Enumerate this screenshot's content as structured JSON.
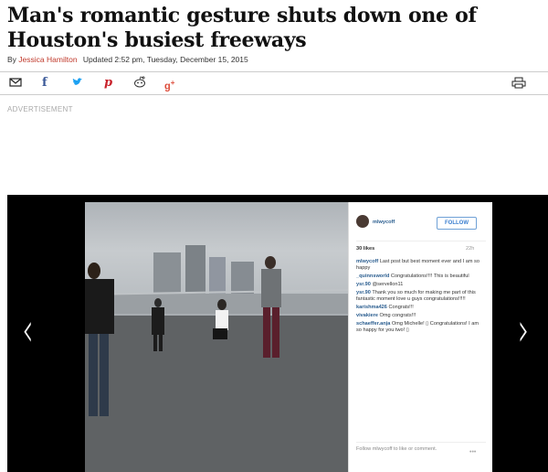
{
  "article": {
    "headline": "Man's romantic gesture shuts down one of Houston's busiest freeways",
    "byline_prefix": "By",
    "author": "Jessica Hamilton",
    "updated": "Updated 2:52 pm, Tuesday, December 15, 2015"
  },
  "share_icons": [
    "email-icon",
    "facebook-icon",
    "twitter-icon",
    "pinterest-icon",
    "reddit-icon",
    "google-plus-icon",
    "print-icon"
  ],
  "advertisement_label": "ADVERTISEMENT",
  "instagram": {
    "username": "mlwycoff",
    "follow_label": "FOLLOW",
    "likes": "30 likes",
    "age": "22h",
    "comments": [
      {
        "user": "mlwycoff",
        "text": "Last post but best moment ever and I am so happy"
      },
      {
        "user": "_quinnsworld",
        "text": "Congratulations!!!! This is beautiful"
      },
      {
        "user": "ysr.90",
        "text": "@servellon11"
      },
      {
        "user": "ysr.90",
        "text": "Thank you so much for making me part of this fantastic moment love u guys congratulations!!!!!"
      },
      {
        "user": "karishma426",
        "text": "Congrats!!!"
      },
      {
        "user": "vivakiere",
        "text": "Omg congrats!!!"
      },
      {
        "user": "schaeffer.anja",
        "text": "Omg Michelle! ▯ Congratulations! I am so happy for you two! ▯"
      }
    ],
    "footer": "Follow mlwycoff to like or comment.",
    "more": "•••"
  },
  "nav": {
    "prev": "‹",
    "next": "›"
  },
  "colors": {
    "author": "#c0392b",
    "username": "#2a5d8f",
    "follow": "#3b7fd0",
    "slideshow_bg": "#000000"
  }
}
